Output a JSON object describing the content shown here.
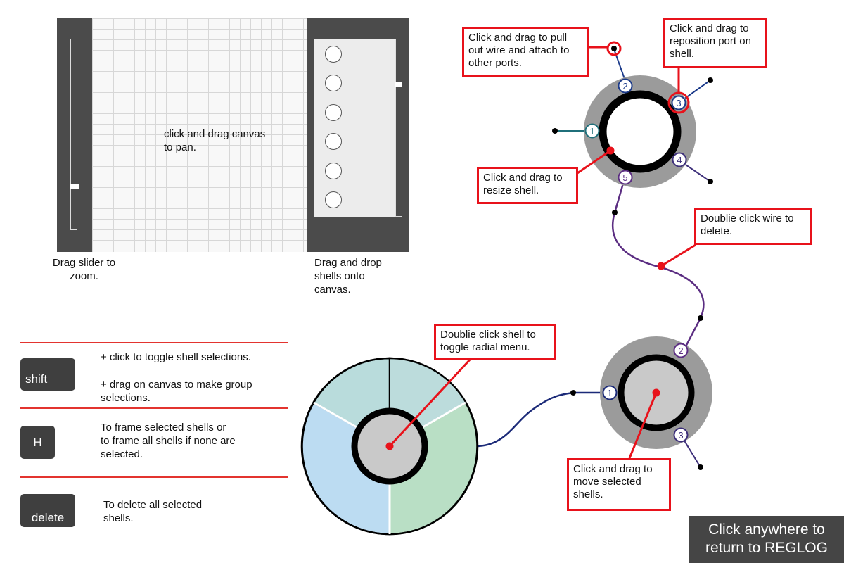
{
  "editor_mock": {
    "canvas_hint": "click and drag canvas to pan.",
    "zoom_caption": "Drag slider to zoom.",
    "shelf_caption": "Drag and drop shells onto canvas."
  },
  "shortcuts": [
    {
      "key": "shift",
      "lines": [
        "+ click to toggle shell selections.",
        "+ drag on canvas to make group selections."
      ]
    },
    {
      "key": "H",
      "lines": [
        "To frame selected shells or to frame all shells if none are selected."
      ]
    },
    {
      "key": "delete",
      "lines": [
        "To delete all selected shells."
      ]
    }
  ],
  "callouts": {
    "pull_wire": "Click and drag to pull out wire and attach to other ports.",
    "reposition_port": "Click and drag to reposition port on shell.",
    "resize_shell": "Click and drag to resize shell.",
    "delete_wire": "Doublie click wire to delete.",
    "radial_menu": "Doublie click shell to toggle radial menu.",
    "move_shells": "Click and drag to move selected shells."
  },
  "ports_top": [
    "1",
    "2",
    "3",
    "4",
    "5"
  ],
  "ports_bottom": [
    "1",
    "2",
    "3"
  ],
  "return_button": "Click anywhere to return to REGLOG",
  "colors": {
    "accent_red": "#e8121b",
    "panel_dark": "#4b4b4b",
    "wire_purple": "#5b2d82",
    "wire_navy": "#1b2a78",
    "port_teal": "#1f6f7a",
    "port_blue": "#1b3a8a"
  }
}
